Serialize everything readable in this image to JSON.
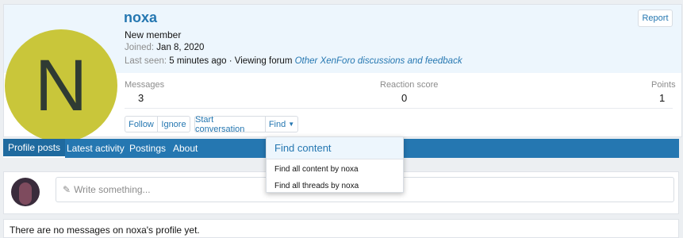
{
  "profile": {
    "avatar_letter": "N",
    "username": "noxa",
    "user_title": "New member",
    "joined_label": "Joined:",
    "joined_value": "Jan 8, 2020",
    "last_seen_label": "Last seen:",
    "last_seen_value": "5 minutes ago",
    "viewing_text": " · Viewing forum ",
    "viewing_forum": "Other XenForo discussions and feedback",
    "report_label": "Report"
  },
  "stats": {
    "messages_label": "Messages",
    "messages_value": "3",
    "reaction_label": "Reaction score",
    "reaction_value": "0",
    "points_label": "Points",
    "points_value": "1"
  },
  "actions": {
    "follow": "Follow",
    "ignore": "Ignore",
    "start_conversation": "Start conversation",
    "find": "Find"
  },
  "tabs": [
    {
      "label": "Profile posts"
    },
    {
      "label": "Latest activity"
    },
    {
      "label": "Postings"
    },
    {
      "label": "About"
    }
  ],
  "dropdown": {
    "title": "Find content",
    "items": [
      "Find all content by noxa",
      "Find all threads by noxa"
    ]
  },
  "post_box": {
    "placeholder": "Write something..."
  },
  "empty_message": "There are no messages on noxa's profile yet.",
  "colors": {
    "accent": "#2577b1",
    "avatar_bg": "#c9c63a",
    "header_bg": "#edf6fd"
  }
}
